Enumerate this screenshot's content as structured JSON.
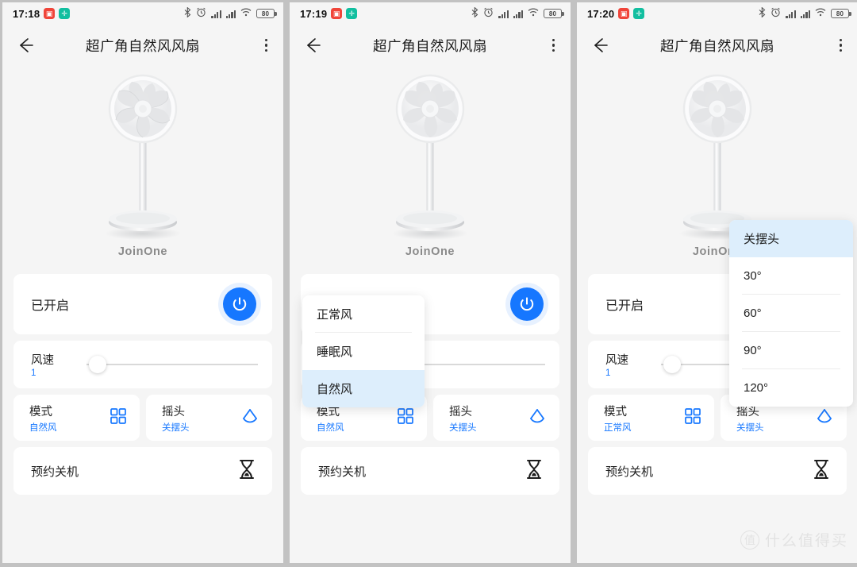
{
  "colors": {
    "accent": "#1677ff",
    "page_bg": "#f5f5f5",
    "card_bg": "#ffffff",
    "gutter": "#c2c2c2",
    "dropdown_selected": "#ddeefc",
    "brand_text": "#8a8a8a"
  },
  "statusbar": {
    "times": [
      "17:18",
      "17:19",
      "17:20"
    ],
    "app_badges": [
      "red-app-icon",
      "green-app-icon"
    ],
    "icons": [
      "bluetooth-icon",
      "alarm-clock-icon",
      "signal-bars-icon",
      "signal-bars-icon",
      "wifi-icon"
    ],
    "battery_level": "80"
  },
  "appbar": {
    "back_icon": "back-arrow-icon",
    "title": "超广角自然风风扇",
    "overflow_icon": "more-vertical-icon"
  },
  "hero": {
    "device_image": "pedestal-fan-image",
    "brand": "JoinOne"
  },
  "power_card": {
    "status_label": "已开启",
    "button_icon": "power-icon"
  },
  "speed_card": {
    "title": "风速",
    "value": "1",
    "slider_position_percent": 8,
    "knob_icon": "slider-knob"
  },
  "mode_card": {
    "title": "模式",
    "icon": "grid-four-icon",
    "values": [
      "自然风",
      "自然风",
      "正常风"
    ]
  },
  "swing_card": {
    "title": "摇头",
    "icon": "oscillate-icon",
    "value": "关摆头"
  },
  "timer_card": {
    "label": "预约关机",
    "icon": "hourglass-icon"
  },
  "mode_dropdown": {
    "items": [
      "正常风",
      "睡眠风",
      "自然风"
    ],
    "selected_index": 2
  },
  "swing_dropdown": {
    "items": [
      "关摆头",
      "30°",
      "60°",
      "90°",
      "120°"
    ],
    "selected_index": 0
  },
  "watermark": {
    "mark": "值",
    "text": "什么值得买"
  }
}
